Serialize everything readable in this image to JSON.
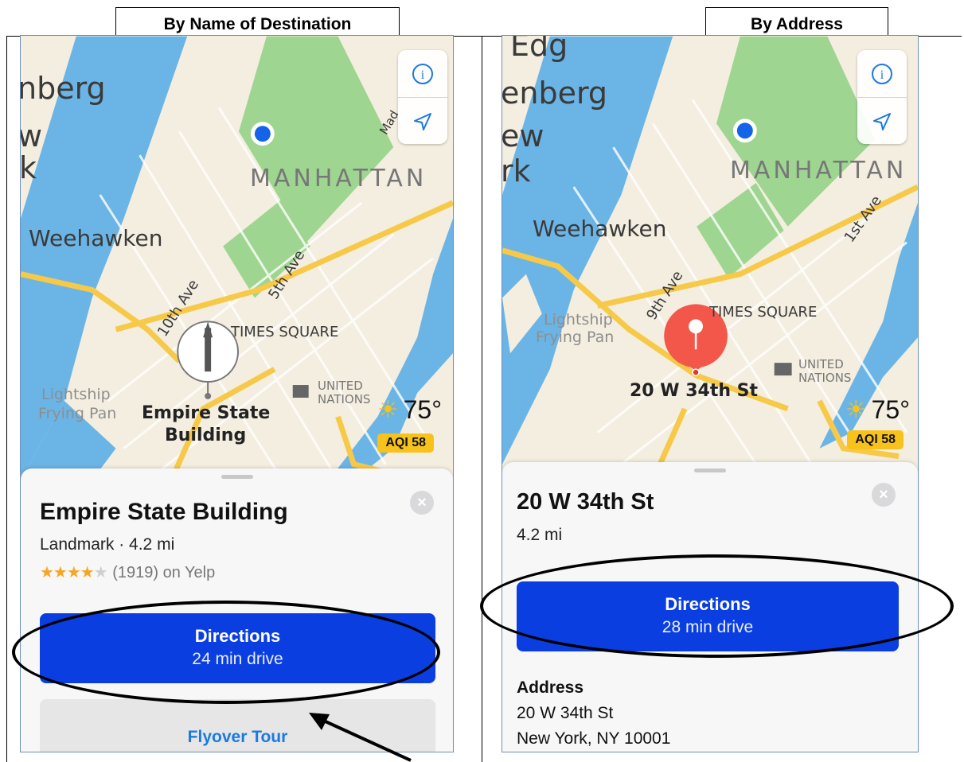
{
  "left": {
    "caption": "By Name of Destination",
    "map": {
      "labels": {
        "berg": "nberg",
        "w": "w",
        "k": "k",
        "manhattan": "MANHATTAN",
        "weehawken": "Weehawken",
        "tenth": "10th Ave",
        "fifth": "5th Ave",
        "times": "TIMES SQUARE",
        "lightship": "Lightship",
        "frying": "Frying Pan",
        "poi": "Empire State",
        "poi2": "Building",
        "un1": "UNITED",
        "un2": "NATIONS",
        "mad": "Mad"
      }
    },
    "weather": {
      "temp": "75°",
      "aqi": "AQI 58"
    },
    "sheet": {
      "title": "Empire State Building",
      "subtitle": "Landmark · 4.2 mi",
      "stars_filled": "★★★★",
      "stars_empty": "★",
      "rating_text": "(1919) on Yelp",
      "directions_label": "Directions",
      "directions_time": "24 min drive",
      "flyover_label": "Flyover Tour",
      "close": "×"
    }
  },
  "right": {
    "caption": "By Address",
    "map": {
      "labels": {
        "berg": "enberg",
        "ew": "ew",
        "rk": "rk",
        "manhattan": "MANHATTAN",
        "weehawken": "Weehawken",
        "ninth": "9th Ave",
        "first": "1st Ave",
        "times": "TIMES SQUARE",
        "lightship": "Lightship",
        "frying": "Frying Pan",
        "pin": "20 W 34th St",
        "un1": "UNITED",
        "un2": "NATIONS",
        "edg": "Edg"
      }
    },
    "weather": {
      "temp": "75°",
      "aqi": "AQI 58"
    },
    "sheet": {
      "title": "20 W 34th St",
      "distance": "4.2 mi",
      "directions_label": "Directions",
      "directions_time": "28 min drive",
      "address_label": "Address",
      "address_line1": "20 W 34th St",
      "address_line2": "New York, NY 10001",
      "close": "×"
    }
  },
  "colors": {
    "directions_blue": "#0a3ee0",
    "flyover_blue": "#1a7ae0",
    "water": "#6bb4e6",
    "park": "#9ed590",
    "highway": "#f7c948",
    "pin": "#f2574a",
    "aqi": "#f7c21b"
  }
}
